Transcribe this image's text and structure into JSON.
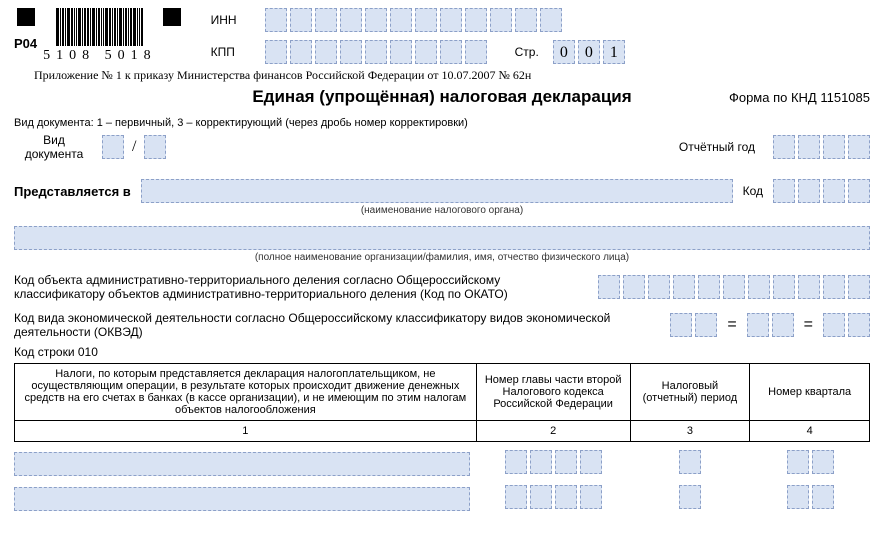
{
  "header": {
    "p04": "Р04",
    "barcode_number": "5108 5018",
    "inn_label": "ИНН",
    "kpp_label": "КПП",
    "page_label": "Стр.",
    "page_digits": [
      "0",
      "0",
      "1"
    ]
  },
  "decree": "Приложение № 1 к приказу Министерства финансов Российской Федерации от 10.07.2007 № 62н",
  "title": "Единая (упрощённая) налоговая декларация",
  "form_code": "Форма по КНД 1151085",
  "doc_type_note": "Вид документа: 1 – первичный, 3 – корректирующий (через дробь номер корректировки)",
  "doc_type_label": "Вид\nдокумента",
  "slash": "/",
  "report_year_label": "Отчётный год",
  "presented_label": "Представляется в",
  "code_label": "Код",
  "tax_authority_caption": "(наименование налогового органа)",
  "fullname_caption": "(полное наименование организации/фамилия, имя, отчество физического лица)",
  "okato_text": "Код объекта административно-территориального деления согласно Общероссийскому классификатору объектов административно-территориального деления (Код по ОКАТО)",
  "okved_text": "Код вида  экономической деятельности согласно Общероссийскому  классификатору видов экономической деятельности (ОКВЭД)",
  "line_code": "Код строки 010",
  "table": {
    "h1": "Налоги, по которым представляется декларация налогоплательщиком, не осуществляющим операции, в результате которых происходит движение денежных средств на его счетах в банках (в кассе организации), и не имеющим по этим налогам объектов налогообложения",
    "h2": "Номер главы части второй Налогового кодекса Российской Федерации",
    "h3": "Налоговый (отчетный) период",
    "h4": "Номер квартала",
    "n1": "1",
    "n2": "2",
    "n3": "3",
    "n4": "4"
  }
}
